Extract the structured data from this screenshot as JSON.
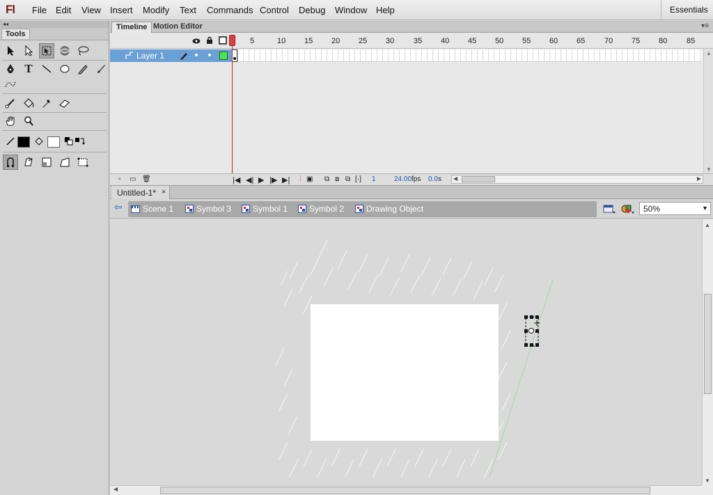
{
  "app": {
    "logo": "Fl",
    "workspace": "Essentials"
  },
  "menu": [
    "File",
    "Edit",
    "View",
    "Insert",
    "Modify",
    "Text",
    "Commands",
    "Control",
    "Debug",
    "Window",
    "Help"
  ],
  "tools": {
    "title": "Tools"
  },
  "timeline": {
    "tabs": [
      "Timeline",
      "Motion Editor"
    ],
    "frame_numbers": [
      "5",
      "10",
      "15",
      "20",
      "25",
      "30",
      "35",
      "40",
      "45",
      "50",
      "55",
      "60",
      "65",
      "70",
      "75",
      "80",
      "85"
    ],
    "layer": {
      "name": "Layer 1"
    },
    "status": {
      "current_frame": "1",
      "fps": "24.00",
      "fps_unit": "fps",
      "time": "0.0",
      "time_unit": "s"
    }
  },
  "document": {
    "tab": "Untitled-1*",
    "close": "×"
  },
  "editbar": {
    "breadcrumbs": [
      "Scene 1",
      "Symbol 3",
      "Symbol 1",
      "Symbol 2",
      "Drawing Object"
    ],
    "zoom": "50%"
  },
  "colors": {
    "selection": "#6aa0d6",
    "playhead": "#d02020",
    "stage": "#ffffff",
    "pasteboard": "#d9d9d9"
  }
}
